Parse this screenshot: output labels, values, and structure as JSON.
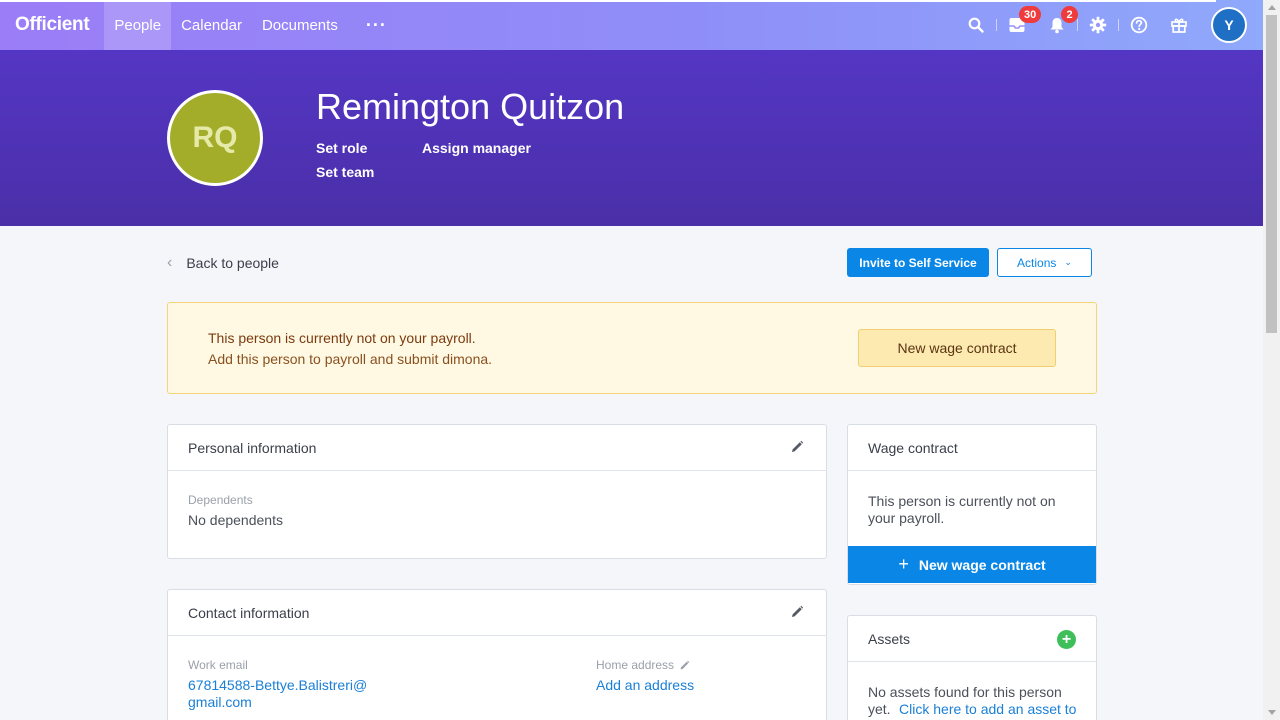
{
  "app": {
    "logo": "Officient"
  },
  "nav": {
    "items": [
      {
        "label": "People",
        "active": true
      },
      {
        "label": "Calendar",
        "active": false
      },
      {
        "label": "Documents",
        "active": false
      }
    ],
    "more": "···",
    "inbox_count": "30",
    "notification_count": "2",
    "user_initial": "Y"
  },
  "person": {
    "initials": "RQ",
    "name": "Remington Quitzon",
    "set_role": "Set role",
    "assign_manager": "Assign manager",
    "set_team": "Set team"
  },
  "actions": {
    "back": "Back to people",
    "invite": "Invite to Self Service",
    "actions": "Actions"
  },
  "alert": {
    "title": "This person is currently not on your payroll.",
    "text": "Add this person to payroll and submit dimona.",
    "button": "New wage contract"
  },
  "personal": {
    "title": "Personal information",
    "dependents_label": "Dependents",
    "dependents_value": "No dependents"
  },
  "contact": {
    "title": "Contact information",
    "work_email_label": "Work email",
    "work_email_line1": "67814588-Bettye.Balistreri@",
    "work_email_line2": "gmail.com",
    "home_address_label": "Home address",
    "home_address_link": "Add an address"
  },
  "wage": {
    "title": "Wage contract",
    "text_line1": "This person is currently not on",
    "text_line2": "your payroll.",
    "button": "New wage contract"
  },
  "assets": {
    "title": "Assets",
    "text_line1": "No assets found for this person",
    "text_line2_prefix": "yet.",
    "link": "Click here to add an asset to"
  },
  "colors": {
    "accent": "#0a87e6",
    "hero": "#4a2fa8",
    "avatar": "#a3ad2a",
    "badge": "#ef3b3b",
    "add": "#3fbf5a"
  }
}
